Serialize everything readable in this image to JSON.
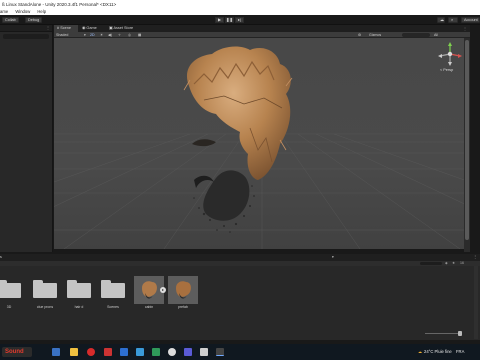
{
  "window": {
    "title": "ß Linux StandAlone - Unity 2020.3.4f1 Personal* <DX11>",
    "menu": [
      "ame",
      "Window",
      "Help"
    ]
  },
  "toolbar": {
    "collab_label": "Collab",
    "services_label": "Debug",
    "account_label": "Account",
    "layers_label": "Layers"
  },
  "scene": {
    "tabs": [
      "Scene",
      "Game",
      "Asset Store"
    ],
    "shading_mode": "Shaded",
    "gizmos_label": "Gizmos",
    "all_label": "All",
    "persp_label": "< Persp"
  },
  "project": {
    "assets": [
      {
        "label": "3D",
        "icon": "folder-icon"
      },
      {
        "label": "clue prons",
        "icon": "folder-icon"
      },
      {
        "label": "hair d",
        "icon": "folder-icon"
      },
      {
        "label": "Scenes",
        "icon": "folder-icon"
      },
      {
        "label": "cabin",
        "icon": "prefab-icon"
      },
      {
        "label": "prefab",
        "icon": "prefab-icon"
      }
    ],
    "count_label": "16"
  },
  "taskbar": {
    "weather": "24°C Pluie fine",
    "lang": "FRA",
    "brand": "Sound"
  },
  "colors": {
    "accent": "#3a72c4",
    "hair": "#b07a49",
    "viewport_bg": "#464646"
  }
}
